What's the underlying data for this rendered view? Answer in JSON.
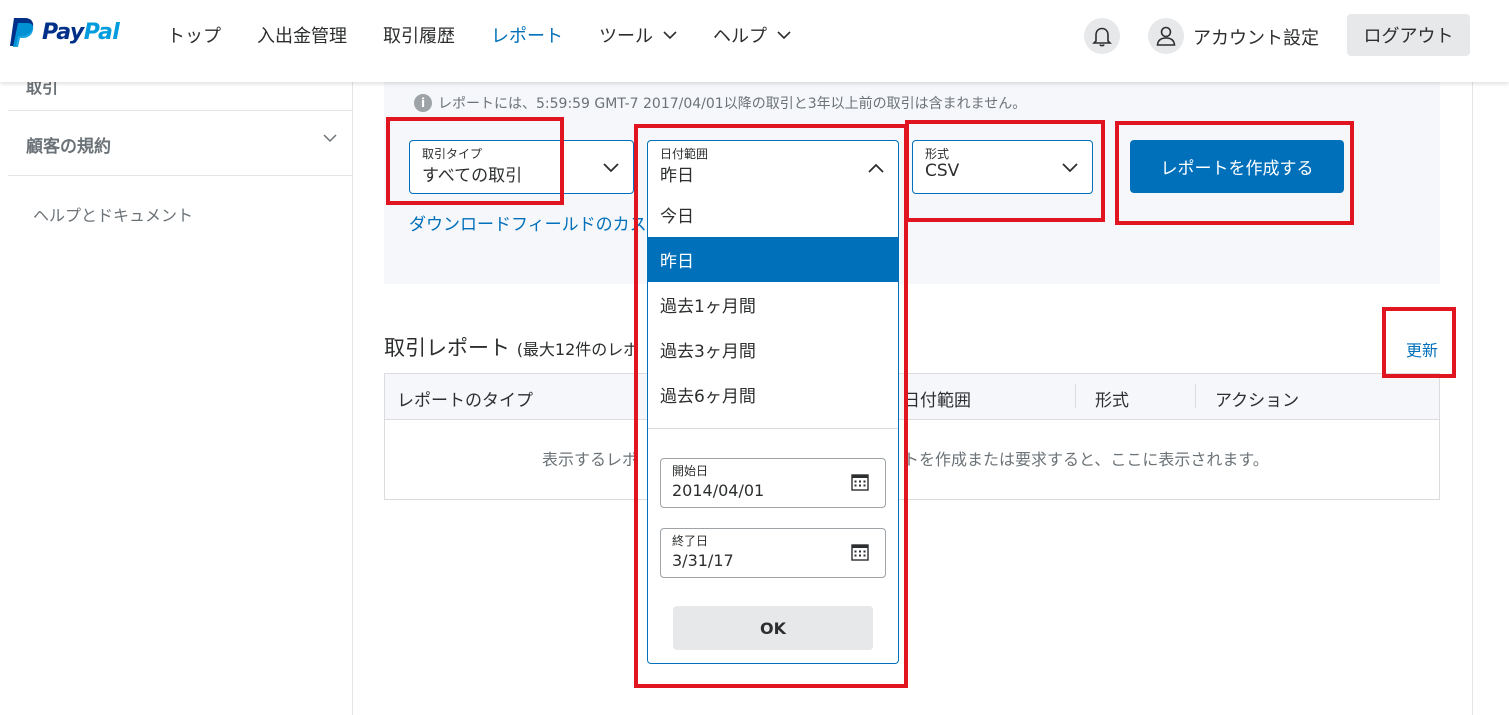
{
  "brand": {
    "logo_text_1": "Pay",
    "logo_text_2": "Pal",
    "colors": {
      "primary": "#0070ba",
      "dark": "#003087",
      "light": "#009cde",
      "highlight": "#e0151f"
    }
  },
  "nav": {
    "items": [
      {
        "label": "トップ"
      },
      {
        "label": "入出金管理"
      },
      {
        "label": "取引履歴"
      },
      {
        "label": "レポート"
      },
      {
        "label": "ツール"
      },
      {
        "label": "ヘルプ"
      }
    ],
    "account_label": "アカウント設定",
    "logout_label": "ログアウト"
  },
  "sidebar": {
    "cut_item": "取引",
    "item_label": "顧客の規約",
    "help_label": "ヘルプとドキュメント"
  },
  "notice": {
    "text": "レポートには、5:59:59 GMT-7 2017/04/01以降の取引と3年以上前の取引は含まれません。"
  },
  "filters": {
    "type": {
      "label": "取引タイプ",
      "value": "すべての取引"
    },
    "date": {
      "label": "日付範囲",
      "value": "昨日"
    },
    "format": {
      "label": "形式",
      "value": "CSV"
    },
    "create_label": "レポートを作成する",
    "customize_link": "ダウンロードフィールドのカス"
  },
  "dropdown": {
    "options": [
      "今日",
      "昨日",
      "過去1ヶ月間",
      "過去3ヶ月間",
      "過去6ヶ月間"
    ],
    "selected": "昨日",
    "start": {
      "label": "開始日",
      "value": "2014/04/01"
    },
    "end": {
      "label": "終了日",
      "value": "3/31/17"
    },
    "ok_label": "OK"
  },
  "reports": {
    "title": "取引レポート",
    "subtitle": "(最大12件のレポ",
    "refresh_label": "更新",
    "columns": [
      "レポートのタイプ",
      "日付範囲",
      "形式",
      "アクション"
    ],
    "empty_left": "表示するレポ",
    "empty_right": "トを作成または要求すると、ここに表示されます。"
  }
}
